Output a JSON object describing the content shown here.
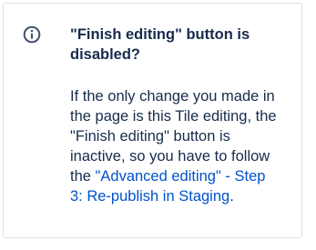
{
  "panel": {
    "icon": "info-icon",
    "title": "\"Finish editing\" button is disabled?",
    "body_prefix": "If the only change you made in the page is this Tile editing, the \"Finish editing\" button is inactive, so you have to follow the ",
    "link_text": "\"Advanced editing\" - Step 3: Re-publish in Staging",
    "body_suffix": ".",
    "colors": {
      "text": "#172b4d",
      "link": "#0052cc",
      "border": "#dfe1e6",
      "icon": "#42526e"
    }
  }
}
